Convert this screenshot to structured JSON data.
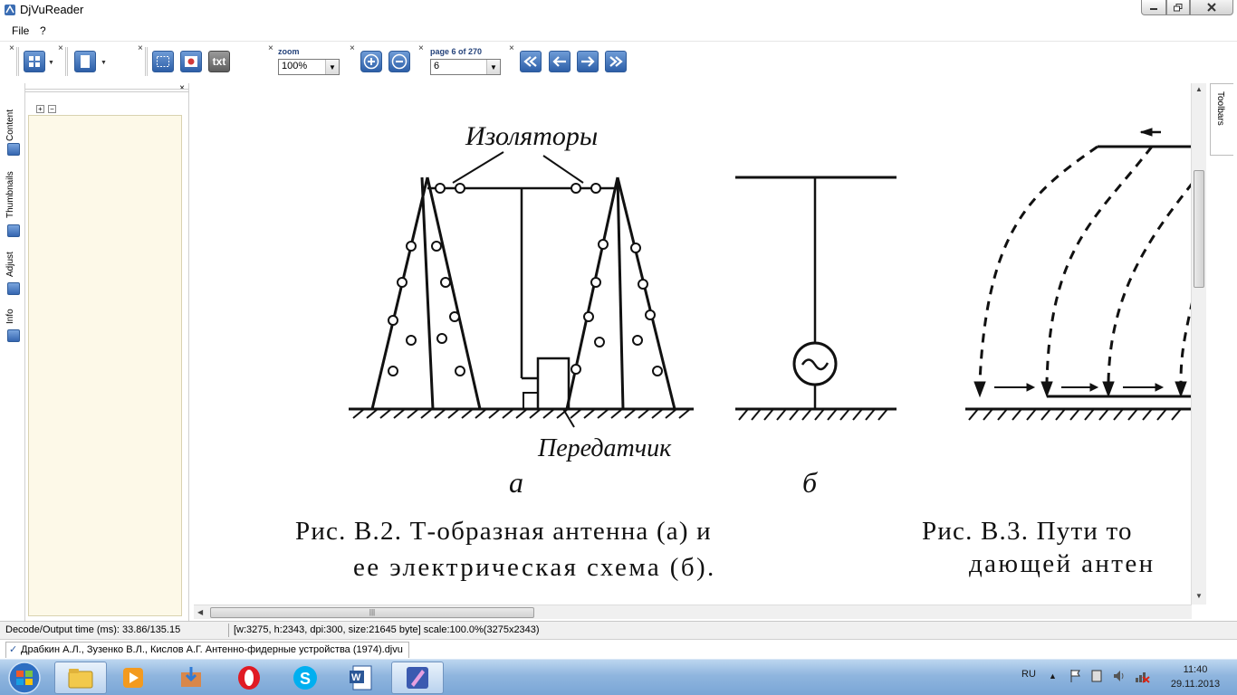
{
  "window": {
    "title": "DjVuReader",
    "controls": [
      "minimize",
      "maximize",
      "close"
    ]
  },
  "menu": {
    "file": "File",
    "help": "?"
  },
  "toolbar": {
    "zoom_label": "zoom",
    "zoom_value": "100%",
    "page_label": "page 6 of 270",
    "page_value": "6",
    "text_button": "txt"
  },
  "sidebar": {
    "tabs": [
      {
        "label": "Content"
      },
      {
        "label": "Thumbnails"
      },
      {
        "label": "Adjust"
      },
      {
        "label": "Info"
      }
    ],
    "expand": "+",
    "collapse": "−"
  },
  "right_panel": {
    "toolbars_label": "Toolbars"
  },
  "document": {
    "label_insulators": "Изоляторы",
    "label_transmitter": "Передатчик",
    "label_a": "а",
    "label_b": "б",
    "caption_fig2_line1": "Рис. В.2. Т-образная антенна (а) и",
    "caption_fig2_line2": "ее электрическая схема (б).",
    "caption_fig3_line1": "Рис. В.3. Пути то",
    "caption_fig3_line2": "дающей антен"
  },
  "status": {
    "decode_time": "Decode/Output time (ms): 33.86/135.15",
    "page_info": "[w:3275, h:2343, dpi:300, size:21645 byte] scale:100.0%(3275x2343)"
  },
  "doc_tab": {
    "filename": "Драбкин А.Л., Зузенко В.Л., Кислов А.Г. Антенно-фидерные устройства (1974).djvu"
  },
  "taskbar": {
    "language": "RU",
    "time": "11:40",
    "date": "29.11.2013",
    "apps": [
      "explorer-icon",
      "media-player-icon",
      "installer-icon",
      "opera-icon",
      "skype-icon",
      "word-icon",
      "djvu-reader-icon"
    ]
  },
  "colors": {
    "accent": "#2d5fa8",
    "panel_bg": "#fdf9e8",
    "taskbar": "#8fb5de"
  }
}
